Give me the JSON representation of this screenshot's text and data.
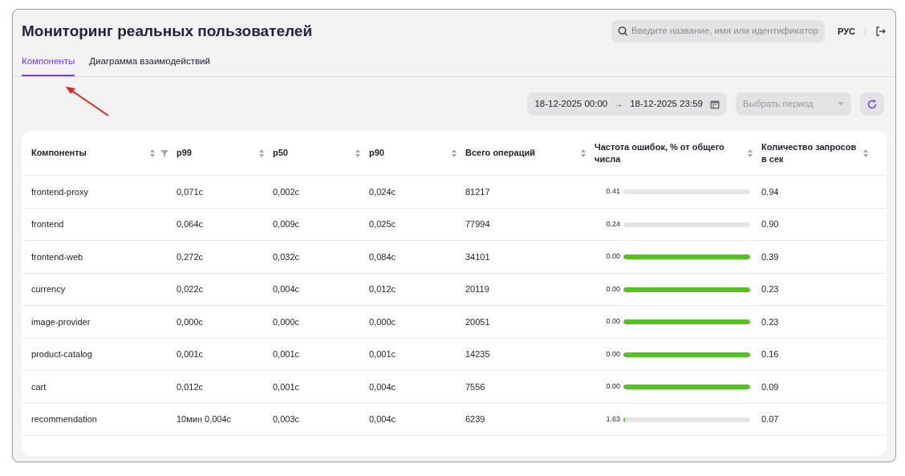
{
  "header": {
    "title": "Мониторинг реальных пользователей",
    "search": {
      "placeholder": "Введите название, имя или идентификатор"
    },
    "language": "РУС"
  },
  "tabs": [
    {
      "label": "Компоненты",
      "selected": true
    },
    {
      "label": "Диаграмма взаимодействий",
      "selected": false
    }
  ],
  "filters": {
    "date_from": "18-12-2025 00:00",
    "arrow": "→",
    "date_to": "18-12-2025 23:59",
    "period": {
      "placeholder": "Выбрать период"
    }
  },
  "table": {
    "columns": [
      {
        "label": "Компоненты",
        "filter": true
      },
      {
        "label": "p99",
        "filter": false
      },
      {
        "label": "p50",
        "filter": false
      },
      {
        "label": "p90",
        "filter": false
      },
      {
        "label": "Всего операций",
        "filter": false
      },
      {
        "label": "Частота ошибок, % от общего числа",
        "filter": false
      },
      {
        "label": "Количество запросов в сек",
        "filter": false
      }
    ],
    "rows": [
      {
        "component": "frontend-proxy",
        "p99": "0,071с",
        "p50": "0,002с",
        "p90": "0,024с",
        "total": "81217",
        "error_rate": "0.41",
        "level": 0,
        "rps": "0.94"
      },
      {
        "component": "frontend",
        "p99": "0,064с",
        "p50": "0,009с",
        "p90": "0,025с",
        "total": "77994",
        "error_rate": "0.24",
        "level": 0,
        "rps": "0.90"
      },
      {
        "component": "frontend-web",
        "p99": "0,272с",
        "p50": "0,032с",
        "p90": "0,084с",
        "total": "34101",
        "error_rate": "0.00",
        "level": 1,
        "rps": "0.39"
      },
      {
        "component": "currency",
        "p99": "0,022с",
        "p50": "0,004с",
        "p90": "0,012с",
        "total": "20119",
        "error_rate": "0.00",
        "level": 1,
        "rps": "0.23"
      },
      {
        "component": "image-provider",
        "p99": "0,000с",
        "p50": "0,000с",
        "p90": "0,000с",
        "total": "20051",
        "error_rate": "0.00",
        "level": 1,
        "rps": "0.23"
      },
      {
        "component": "product-catalog",
        "p99": "0,001с",
        "p50": "0,001с",
        "p90": "0,001с",
        "total": "14235",
        "error_rate": "0.00",
        "level": 1,
        "rps": "0.16"
      },
      {
        "component": "cart",
        "p99": "0,012с",
        "p50": "0,001с",
        "p90": "0,004с",
        "total": "7556",
        "error_rate": "0.00",
        "level": 1,
        "rps": "0.09"
      },
      {
        "component": "recommendation",
        "p99": "10мин 0,004с",
        "p50": "0,003с",
        "p90": "0,004с",
        "total": "6239",
        "error_rate": "1.63",
        "level": 0.01,
        "rps": "0.07"
      }
    ]
  }
}
